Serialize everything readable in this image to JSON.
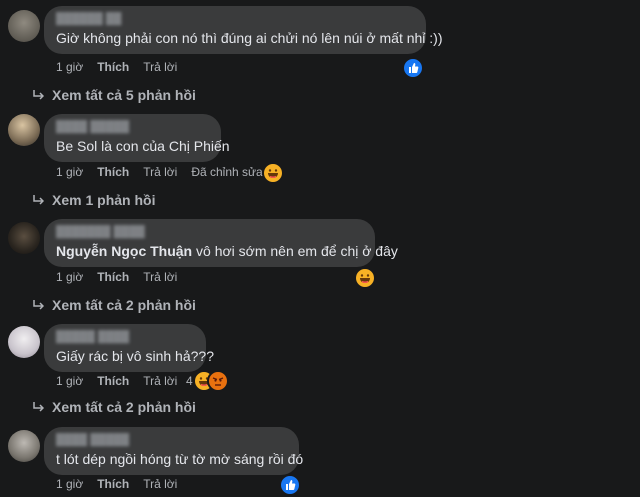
{
  "comments": [
    {
      "text": "Giờ không phải con nó thì đúng ai chửi nó lên núi ở mất nhỉ :))",
      "time": "1 giờ",
      "like": "Thích",
      "reply": "Trả lời",
      "reactions": [
        "like"
      ]
    },
    {
      "text": "Be Sol là con của Chị Phiến",
      "time": "1 giờ",
      "like": "Thích",
      "reply": "Trả lời",
      "edited": "Đã chỉnh sửa",
      "reactions": [
        "haha"
      ]
    },
    {
      "mention": "Nguyễn Ngọc Thuận",
      "text": " vô hơi sớm nên em để chị ở đây",
      "time": "1 giờ",
      "like": "Thích",
      "reply": "Trả lời",
      "reactions": [
        "haha"
      ]
    },
    {
      "text": "Giấy rác bị vô sinh hả???",
      "time": "1 giờ",
      "like": "Thích",
      "reply": "Trả lời",
      "reaction_count": "4",
      "reactions": [
        "haha",
        "angry"
      ]
    },
    {
      "text": "t lót dép ngồi hóng từ tờ mờ sáng rồi đó",
      "time": "1 giờ",
      "like": "Thích",
      "reply": "Trả lời",
      "reactions": [
        "like"
      ]
    }
  ],
  "reply_links": [
    "Xem tất cả 5 phản hồi",
    "Xem 1 phản hồi",
    "Xem tất cả 2 phản hồi",
    "Xem tất cả 2 phản hồi"
  ],
  "colors": {
    "background": "#18191a",
    "bubble": "#3a3b3c",
    "text": "#e4e6eb",
    "secondary": "#b0b3b8",
    "like": "#1877f2",
    "haha": "#f7b125",
    "angry": "#e9710f"
  }
}
